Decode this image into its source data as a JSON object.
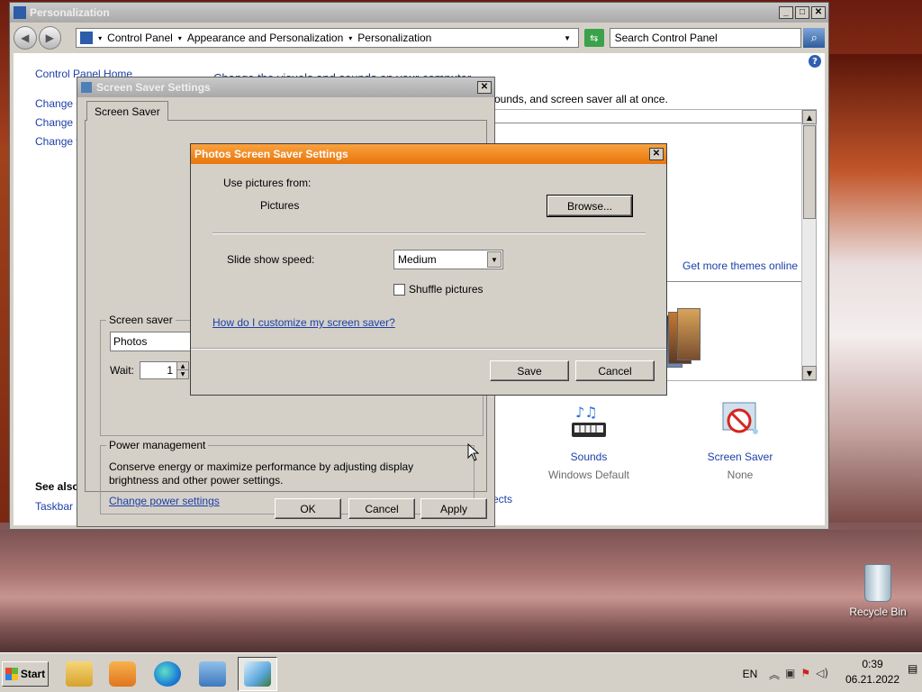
{
  "desktop": {
    "recycle_bin_label": "Recycle Bin"
  },
  "personalization": {
    "title": "Personalization",
    "breadcrumbs": [
      "Control Panel",
      "Appearance and Personalization",
      "Personalization"
    ],
    "search_placeholder": "Search Control Panel",
    "sidebar": {
      "home": "Control Panel Home",
      "items": [
        "Change d",
        "Change m",
        "Change y"
      ],
      "see_also_heading": "See also",
      "see_also_items": [
        "Taskbar a"
      ]
    },
    "heading": "Change the visuals and sounds on your computer",
    "description": "ounds, and screen saver all at once.",
    "get_more_themes": "Get more themes online",
    "partial_link": "ects",
    "tiles": [
      {
        "name": "Sounds",
        "value": "Windows Default",
        "icon": "sounds-icon"
      },
      {
        "name": "Screen Saver",
        "value": "None",
        "icon": "screen-saver-icon"
      }
    ]
  },
  "ss_settings": {
    "title": "Screen Saver Settings",
    "tab": "Screen Saver",
    "screen_saver_group": "Screen saver",
    "screen_saver_value": "Photos",
    "wait_label": "Wait:",
    "wait_value": "1",
    "power_group": "Power management",
    "power_text_1": "Conserve energy or maximize performance by adjusting display",
    "power_text_2": "brightness and other power settings.",
    "power_link": "Change power settings",
    "ok": "OK",
    "cancel": "Cancel",
    "apply": "Apply"
  },
  "photos": {
    "title": "Photos Screen Saver Settings",
    "use_pictures_label": "Use pictures from:",
    "pictures_value": "Pictures",
    "browse": "Browse...",
    "speed_label": "Slide show speed:",
    "speed_value": "Medium",
    "shuffle_label": "Shuffle pictures",
    "shuffle_checked": false,
    "help_link": "How do I customize my screen saver?",
    "save": "Save",
    "cancel": "Cancel"
  },
  "taskbar": {
    "start": "Start",
    "apps": [
      "explorer-icon",
      "media-player-icon",
      "edge-icon",
      "control-panel-icon",
      "display-settings-icon"
    ],
    "language": "EN",
    "time": "0:39",
    "date": "06.21.2022"
  }
}
